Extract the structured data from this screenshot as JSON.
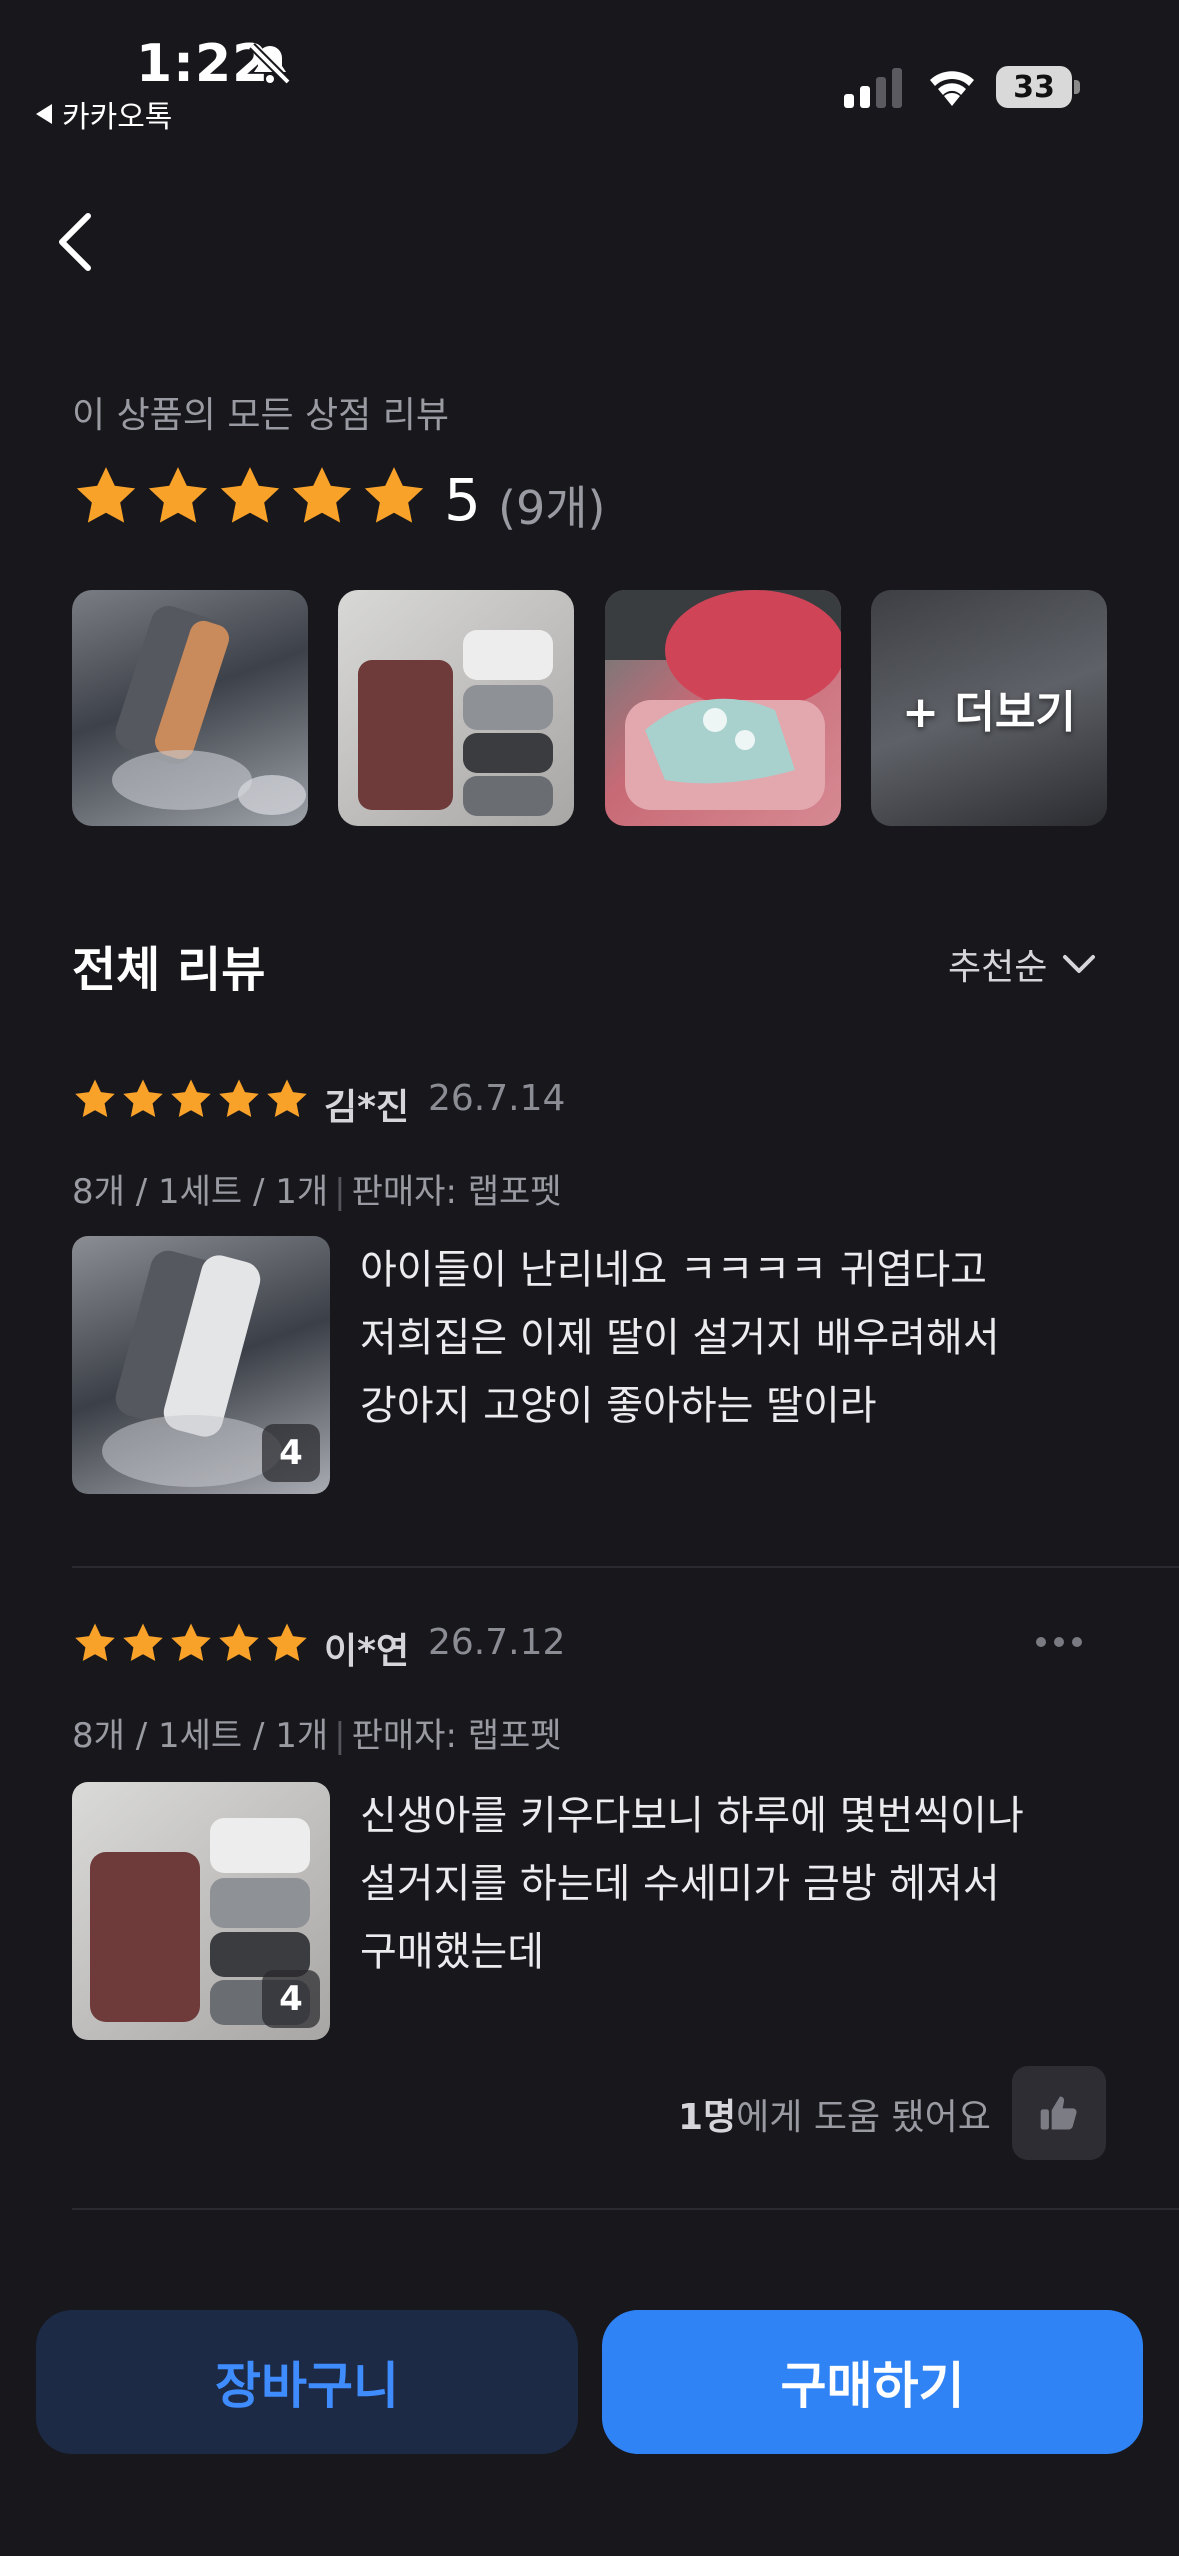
{
  "status_bar": {
    "time": "1:22",
    "back_app": "카카오톡",
    "battery": "33"
  },
  "summary": {
    "caption": "이 상품의 모든 상점 리뷰",
    "rating": "5",
    "rating_stars": 5,
    "count": "(9개)",
    "more_photos": "+ 더보기"
  },
  "reviews_section": {
    "title": "전체 리뷰",
    "sort": "추천순"
  },
  "reviews": [
    {
      "name": "김*진",
      "date": "26.7.14",
      "stars": 5,
      "option": "8개 / 1세트 / 1개",
      "seller": "판매자: 랩포펫",
      "photo_count": "4",
      "text_lines": [
        "아이들이 난리네요 ㅋㅋㅋㅋ 귀엽다고",
        "저희집은 이제 딸이 설거지 배우려해서",
        "강아지 고양이 좋아하는 딸이라"
      ]
    },
    {
      "name": "이*연",
      "date": "26.7.12",
      "stars": 5,
      "option": "8개 / 1세트 / 1개",
      "seller": "판매자: 랩포펫",
      "photo_count": "4",
      "text_lines": [
        "신생아를 키우다보니 하루에 몇번씩이나",
        "설거지를 하는데 수세미가 금방 헤져서",
        "구매했는데"
      ],
      "helpful_count": "1명",
      "helpful_suffix": "에게 도움 됐어요"
    }
  ],
  "bottom_bar": {
    "cart": "장바구니",
    "buy": "구매하기"
  },
  "colors": {
    "background": "#17171c",
    "star": "#f9a229",
    "primary": "#2f83f5",
    "cart_bg": "#1c2a45",
    "cart_text": "#3f8cff"
  }
}
